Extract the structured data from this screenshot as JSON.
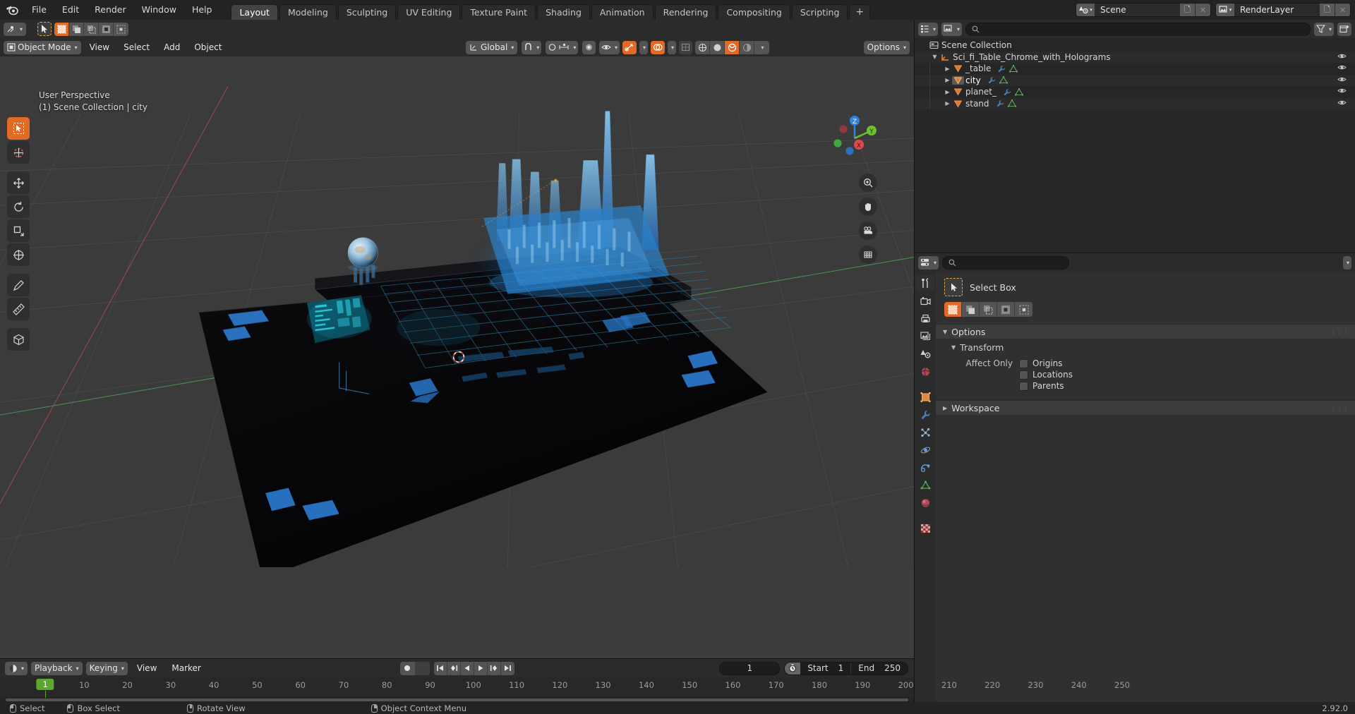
{
  "app": {
    "name": "Blender",
    "version": "2.92.0"
  },
  "topbar": {
    "menus": [
      "File",
      "Edit",
      "Render",
      "Window",
      "Help"
    ],
    "workspace_tabs": [
      {
        "label": "Layout",
        "active": true
      },
      {
        "label": "Modeling",
        "active": false
      },
      {
        "label": "Sculpting",
        "active": false
      },
      {
        "label": "UV Editing",
        "active": false
      },
      {
        "label": "Texture Paint",
        "active": false
      },
      {
        "label": "Shading",
        "active": false
      },
      {
        "label": "Animation",
        "active": false
      },
      {
        "label": "Rendering",
        "active": false
      },
      {
        "label": "Compositing",
        "active": false
      },
      {
        "label": "Scripting",
        "active": false
      }
    ],
    "add_workspace_label": "+",
    "scene_name": "Scene",
    "view_layer_name": "RenderLayer"
  },
  "viewport_header": {
    "mode": "Object Mode",
    "menus": [
      "View",
      "Select",
      "Add",
      "Object"
    ],
    "transform_orientation": "Global",
    "options_label": "Options"
  },
  "viewport": {
    "perspective": "User Perspective",
    "scene_info": "(1) Scene Collection | city",
    "grid_color": "#545454",
    "bg_color": "#3b3b3b",
    "x_axis_color": "#9c4b4f",
    "y_axis_color": "#4a8c4a",
    "gizmo_axes": [
      {
        "label": "Z",
        "color": "#2f83e3"
      },
      {
        "label": "Y",
        "color": "#6ec02f"
      },
      {
        "label": "X",
        "color": "#e2494f"
      }
    ],
    "tools": [
      "tweak-select-box-tool",
      "cursor-tool",
      "move-tool",
      "rotate-tool",
      "scale-tool",
      "transform-tool",
      "annotate-tool",
      "measure-tool",
      "add-cube-tool"
    ],
    "nav_buttons": [
      "zoom-icon",
      "pan-hand-icon",
      "camera-view-icon",
      "orthographic-toggle-icon"
    ]
  },
  "outliner": {
    "search_placeholder": "",
    "scene_collection_label": "Scene Collection",
    "items": [
      {
        "label": "Sci_fi_Table_Chrome_with_Holograms",
        "type": "empty",
        "depth": 1,
        "expanded": true,
        "selected": false,
        "mods": []
      },
      {
        "label": "_table",
        "type": "mesh",
        "depth": 2,
        "expanded": false,
        "selected": false,
        "mods": [
          "modifier-wrench-icon",
          "mesh-data-icon"
        ]
      },
      {
        "label": "city",
        "type": "mesh",
        "depth": 2,
        "expanded": false,
        "selected": true,
        "mods": [
          "modifier-wrench-icon",
          "mesh-data-icon"
        ]
      },
      {
        "label": "planet_",
        "type": "mesh",
        "depth": 2,
        "expanded": false,
        "selected": false,
        "mods": [
          "modifier-wrench-icon",
          "mesh-data-icon"
        ]
      },
      {
        "label": "stand",
        "type": "mesh",
        "depth": 2,
        "expanded": false,
        "selected": false,
        "mods": [
          "modifier-wrench-icon",
          "mesh-data-icon"
        ]
      }
    ]
  },
  "properties": {
    "search_placeholder": "",
    "active_tab": "tool",
    "tabs": [
      {
        "name": "tool",
        "icon": "tool-screwdriver-wrench-icon",
        "active": true
      },
      {
        "name": "render",
        "icon": "render-camera-back-icon",
        "active": false
      },
      {
        "name": "output",
        "icon": "output-printer-icon",
        "active": false
      },
      {
        "name": "view-layer",
        "icon": "view-layer-images-icon",
        "active": false
      },
      {
        "name": "scene",
        "icon": "scene-cone-sphere-icon",
        "active": false
      },
      {
        "name": "world",
        "icon": "world-globe-icon",
        "active": false
      },
      {
        "name": "object",
        "icon": "object-orange-square-icon",
        "active": false
      },
      {
        "name": "modifiers",
        "icon": "modifier-wrench-icon",
        "active": false
      },
      {
        "name": "particles",
        "icon": "particles-icon",
        "active": false
      },
      {
        "name": "physics",
        "icon": "physics-orbit-icon",
        "active": false
      },
      {
        "name": "constraints",
        "icon": "constraints-clamp-icon",
        "active": false
      },
      {
        "name": "object-data",
        "icon": "mesh-data-triangle-icon",
        "active": false
      },
      {
        "name": "material",
        "icon": "material-sphere-icon",
        "active": false
      },
      {
        "name": "texture",
        "icon": "texture-checker-icon",
        "active": false
      }
    ],
    "active_tool": {
      "label": "Select Box",
      "modes": [
        "set-new",
        "extend",
        "subtract",
        "invert",
        "intersect"
      ],
      "active_mode_index": 0
    },
    "panels": [
      {
        "label": "Options",
        "expanded": true,
        "subpanels": [
          {
            "label": "Transform",
            "expanded": true,
            "field_label": "Affect Only",
            "checkboxes": [
              {
                "label": "Origins",
                "checked": false
              },
              {
                "label": "Locations",
                "checked": false
              },
              {
                "label": "Parents",
                "checked": false
              }
            ]
          }
        ]
      },
      {
        "label": "Workspace",
        "expanded": false,
        "subpanels": []
      }
    ]
  },
  "timeline": {
    "menus": [
      "Playback",
      "Keying",
      "View",
      "Marker"
    ],
    "current_frame": "1",
    "start_label": "Start",
    "start_value": "1",
    "end_label": "End",
    "end_value": "250",
    "playhead_frame": 1,
    "ticks": [
      10,
      20,
      30,
      40,
      50,
      60,
      70,
      80,
      90,
      100,
      110,
      120,
      130,
      140,
      150,
      160,
      170,
      180,
      190,
      200,
      210,
      220,
      230,
      240,
      250
    ],
    "transport_buttons": [
      "jump-to-start-icon",
      "jump-to-prev-keyframe-icon",
      "play-reverse-icon",
      "play-icon",
      "jump-to-next-keyframe-icon",
      "jump-to-end-icon"
    ]
  },
  "statusbar": {
    "hints": [
      {
        "mouse": "left",
        "label": "Select"
      },
      {
        "mouse": "left-drag",
        "label": "Box Select"
      },
      {
        "mouse": "middle",
        "label": "Rotate View"
      },
      {
        "mouse": "right",
        "label": "Object Context Menu"
      }
    ],
    "version": "2.92.0"
  }
}
